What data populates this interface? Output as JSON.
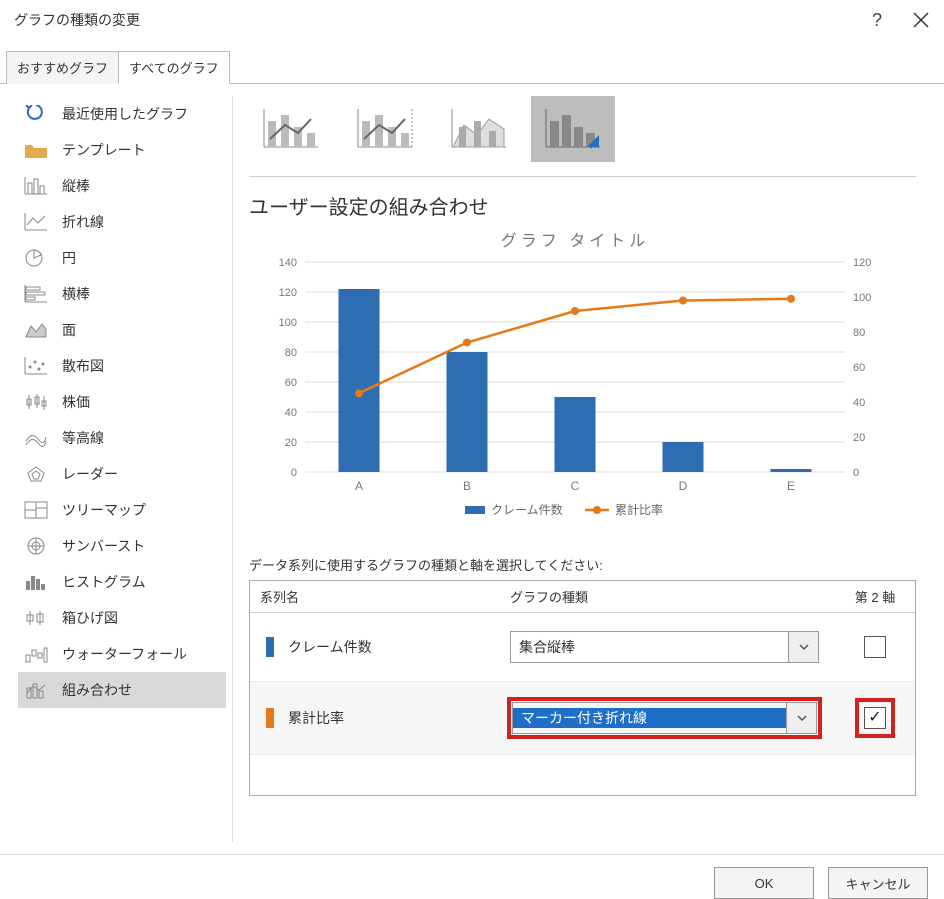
{
  "window": {
    "title": "グラフの種類の変更"
  },
  "tabs": [
    {
      "label": "おすすめグラフ"
    },
    {
      "label": "すべてのグラフ"
    }
  ],
  "sidebar": {
    "items": [
      "最近使用したグラフ",
      "テンプレート",
      "縦棒",
      "折れ線",
      "円",
      "横棒",
      "面",
      "散布図",
      "株価",
      "等高線",
      "レーダー",
      "ツリーマップ",
      "サンバースト",
      "ヒストグラム",
      "箱ひげ図",
      "ウォーターフォール",
      "組み合わせ"
    ]
  },
  "main": {
    "subtype_title": "ユーザー設定の組み合わせ",
    "series_instruction": "データ系列に使用するグラフの種類と軸を選択してください:",
    "table": {
      "header_name": "系列名",
      "header_type": "グラフの種類",
      "header_axis": "第 2 軸",
      "rows": [
        {
          "name": "クレーム件数",
          "type": "集合縦棒"
        },
        {
          "name": "累計比率",
          "type": "マーカー付き折れ線"
        }
      ]
    }
  },
  "chart_data": {
    "type": "bar+line",
    "title": "グラフ タイトル",
    "categories": [
      "A",
      "B",
      "C",
      "D",
      "E"
    ],
    "series": [
      {
        "name": "クレーム件数",
        "type": "bar",
        "axis": "left",
        "values": [
          122,
          80,
          50,
          20,
          2
        ]
      },
      {
        "name": "累計比率",
        "type": "line",
        "axis": "right",
        "values": [
          45,
          74,
          92,
          98,
          99
        ]
      }
    ],
    "left_axis": {
      "min": 0,
      "max": 140,
      "step": 20
    },
    "right_axis": {
      "min": 0,
      "max": 120,
      "step": 20
    },
    "legend": [
      "クレーム件数",
      "累計比率"
    ]
  },
  "footer": {
    "ok": "OK",
    "cancel": "キャンセル"
  }
}
